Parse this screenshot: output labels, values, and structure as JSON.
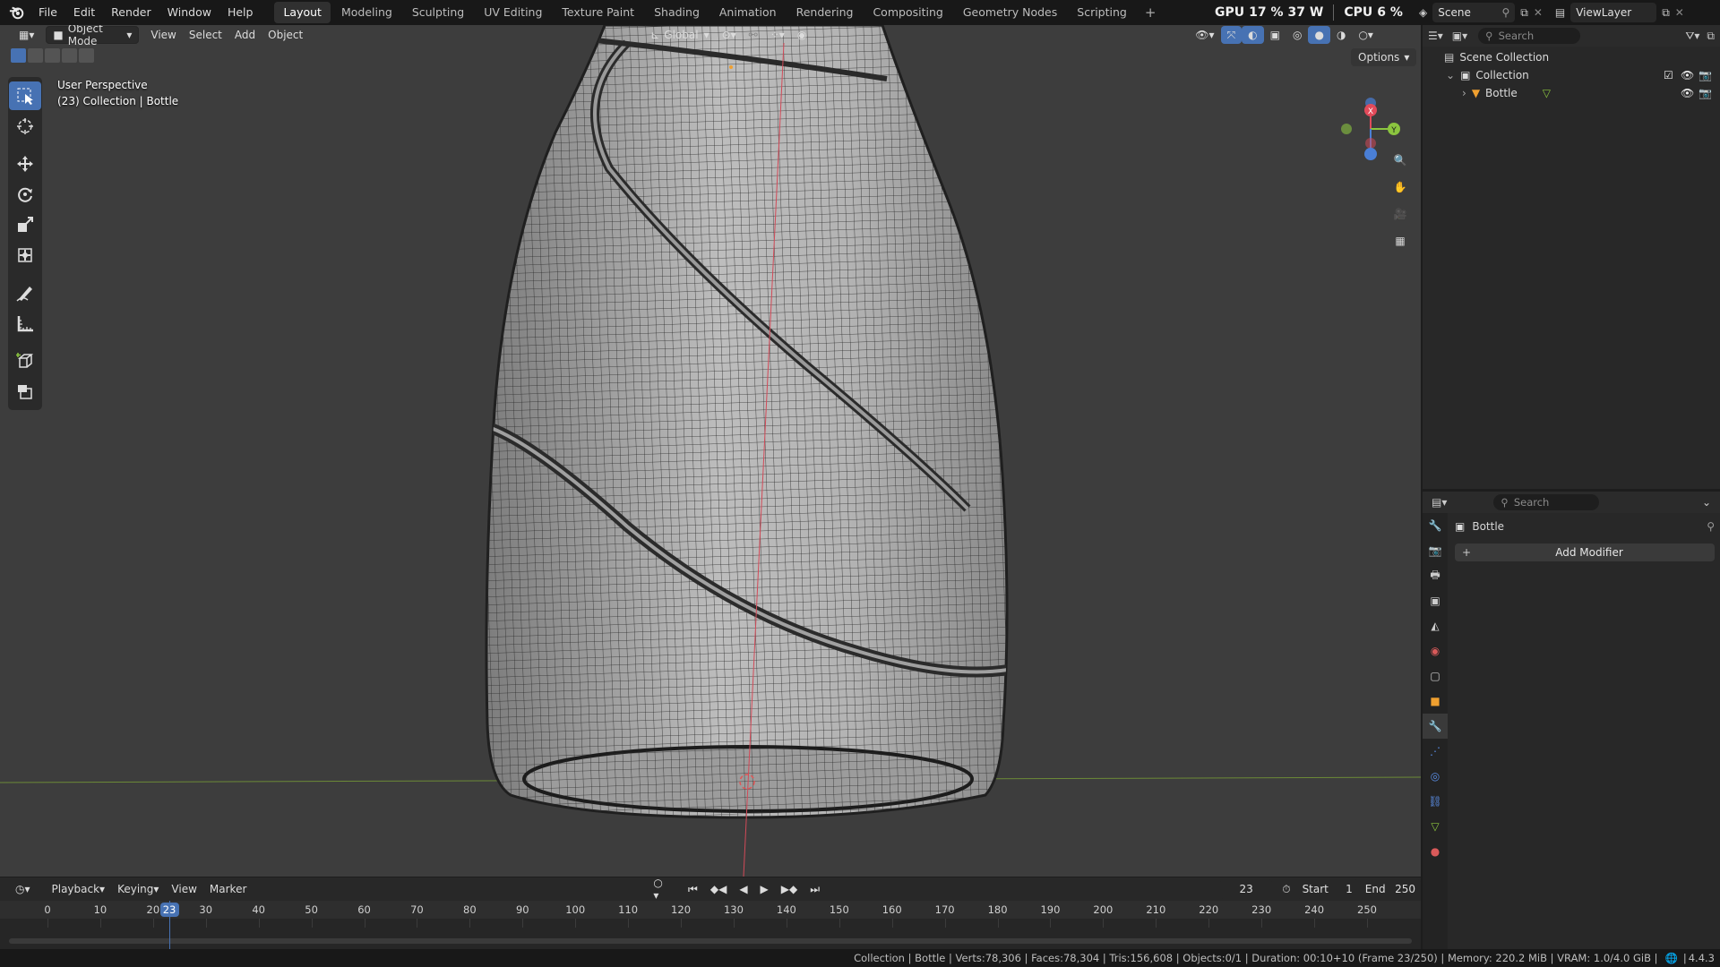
{
  "topbar": {
    "menus": [
      "File",
      "Edit",
      "Render",
      "Window",
      "Help"
    ],
    "workspaces": [
      "Layout",
      "Modeling",
      "Sculpting",
      "UV Editing",
      "Texture Paint",
      "Shading",
      "Animation",
      "Rendering",
      "Compositing",
      "Geometry Nodes",
      "Scripting"
    ],
    "active_workspace": "Layout",
    "add_workspace": "+",
    "gpu_label": "GPU",
    "gpu_value": "17 %",
    "gpu_power": "37 W",
    "cpu_label": "CPU",
    "cpu_value": "6 %",
    "scene_name": "Scene",
    "view_layer": "ViewLayer"
  },
  "viewport": {
    "mode": "Object Mode",
    "menus": [
      "View",
      "Select",
      "Add",
      "Object"
    ],
    "orientation": "Global",
    "options_label": "Options",
    "info_line1": "User Perspective",
    "info_line2": "(23) Collection | Bottle",
    "gizmo": {
      "x": "X",
      "y": "Y",
      "z": "Z"
    },
    "tools": [
      "select-box",
      "cursor",
      "move",
      "rotate",
      "scale",
      "transform",
      "annotate",
      "measure",
      "add-cube",
      "add-primitive"
    ],
    "active_tool": "select-box"
  },
  "timeline": {
    "menus": [
      "Playback",
      "Keying",
      "View",
      "Marker"
    ],
    "current_frame": "23",
    "start_label": "Start",
    "start_value": "1",
    "end_label": "End",
    "end_value": "250",
    "ticks": [
      "0",
      "10",
      "20",
      "30",
      "40",
      "50",
      "60",
      "70",
      "80",
      "90",
      "100",
      "110",
      "120",
      "130",
      "140",
      "150",
      "160",
      "170",
      "180",
      "190",
      "200",
      "210",
      "220",
      "230",
      "240",
      "250"
    ],
    "playhead_label": "23"
  },
  "outliner": {
    "search_placeholder": "Search",
    "scene_collection": "Scene Collection",
    "collection": "Collection",
    "object": "Bottle"
  },
  "properties": {
    "search_placeholder": "Search",
    "object_name": "Bottle",
    "add_modifier": "Add Modifier",
    "add_modifier_icon": "+",
    "active_tab": "modifiers"
  },
  "statusbar": {
    "text": "Collection | Bottle | Verts:78,306 | Faces:78,304 | Tris:156,608 | Objects:0/1 | Duration: 00:10+10 (Frame 23/250) | Memory: 220.2 MiB | VRAM: 1.0/4.0 GiB |",
    "version": "4.4.3"
  },
  "colors": {
    "accent": "#4772b3",
    "viewport_bg": "#3d3d3d",
    "panel_bg": "#282828",
    "x_axis": "#e24a5a",
    "y_axis": "#8bc53f",
    "z_axis": "#4a7fd6"
  }
}
